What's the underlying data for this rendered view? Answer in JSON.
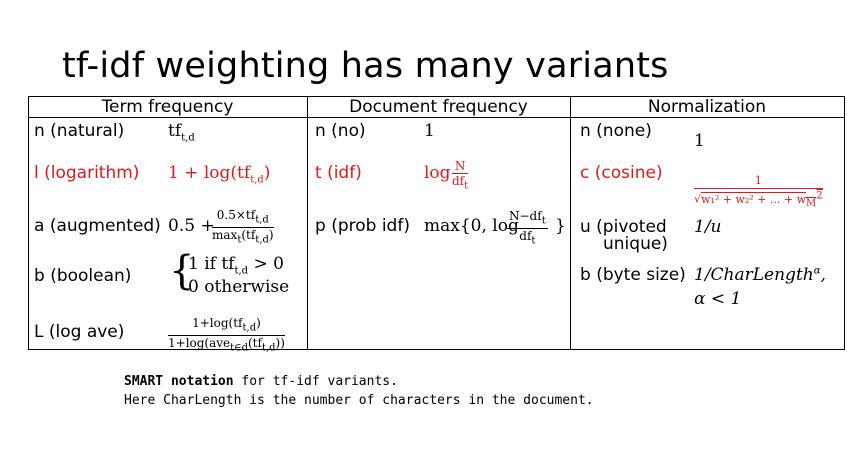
{
  "title": "tf-idf weighting has many variants",
  "headers": {
    "term": "Term frequency",
    "doc": "Document frequency",
    "norm": "Normalization"
  },
  "term_rows": [
    {
      "label": "n (natural)",
      "formula": "tf",
      "sub": "t,d"
    },
    {
      "label": "l (logarithm)",
      "formula": "1 + log(tf",
      "sub": "t,d",
      "tail": ")"
    },
    {
      "label": "a (augmented)",
      "prefix": "0.5 +",
      "num": "0.5×tf",
      "num_sub": "t,d",
      "den": "max",
      "den_sub": "t",
      "den_tail": "(tf",
      "den_sub2": "t,d",
      "den_end": ")"
    },
    {
      "label": "b (boolean)",
      "case1": "1  if tf",
      "case1_sub": "t,d",
      "case1_tail": " > 0",
      "case2": "0  otherwise"
    },
    {
      "label": "L (log ave)",
      "num": "1+log(tf",
      "num_sub": "t,d",
      "num_end": ")",
      "den": "1+log(ave",
      "den_sub": "t∈d",
      "den_tail": "(tf",
      "den_sub2": "t,d",
      "den_end": "))"
    }
  ],
  "doc_rows": [
    {
      "label": "n (no)",
      "formula": "1"
    },
    {
      "label": "t (idf)",
      "pre": "log",
      "num": "N",
      "den": "df",
      "den_sub": "t"
    },
    {
      "label": "p (prob idf)",
      "pre": "max{0, log",
      "num": "N−df",
      "num_sub": "t",
      "den": "df",
      "den_sub": "t",
      "post": "}"
    }
  ],
  "norm_rows": [
    {
      "label": "n (none)",
      "formula": "1"
    },
    {
      "label": "c (cosine)",
      "num": "1",
      "den": "w₁² + w₂² + ... + w",
      "den_sub": "M",
      "den_sup": "2"
    },
    {
      "label": "u (pivoted",
      "label2": "unique)",
      "formula": "1/u"
    },
    {
      "label": "b (byte size)",
      "formula": "1/CharLength",
      "sup": "α",
      "tail": ",",
      "line2": "α < 1"
    }
  ],
  "caption": {
    "bold": "SMART notation",
    "rest": " for tf-idf variants.",
    "line2": "Here CharLength is the number of characters in the document."
  },
  "colors": {
    "red": "#dd1a1a",
    "black": "#000000"
  }
}
